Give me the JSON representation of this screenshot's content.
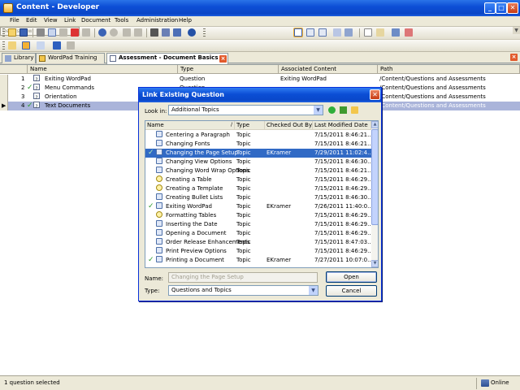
{
  "window": {
    "title": "Content - Developer"
  },
  "colors": {
    "accent": "#0a45c6",
    "selection": "#316ac5",
    "grid_selection": "#aab4da",
    "check": "#2c9b2c"
  },
  "menu": [
    "File",
    "Edit",
    "View",
    "Link",
    "Document",
    "Tools",
    "Administration",
    "Help"
  ],
  "toolbar": {
    "view_select": "Details view"
  },
  "tabs": [
    {
      "label": "Library",
      "icon": "library-icon"
    },
    {
      "label": "WordPad Training",
      "icon": "module-icon"
    },
    {
      "label": "Assessment - Document Basics",
      "icon": "assessment-icon",
      "active": true
    }
  ],
  "grid": {
    "columns": [
      "Name",
      "Type",
      "Associated Content",
      "Path"
    ],
    "rows": [
      {
        "num": "1",
        "name": "Exiting WordPad",
        "type": "Question",
        "content": "Exiting WordPad",
        "path": "/Content/Questions and Assessments",
        "check": false,
        "selected": false
      },
      {
        "num": "2",
        "name": "Menu Commands",
        "type": "Question",
        "content": "",
        "path": "/Content/Questions and Assessments",
        "check": true,
        "selected": false
      },
      {
        "num": "3",
        "name": "Orientation",
        "type": "Question",
        "content": "",
        "path": "/Content/Questions and Assessments",
        "check": false,
        "selected": false
      },
      {
        "num": "4",
        "name": "Text Documents",
        "type": "",
        "content": "",
        "path": "/Content/Questions and Assessments",
        "check": true,
        "selected": true
      }
    ]
  },
  "dialog": {
    "title": "Link Existing Question",
    "lookin_label": "Look in:",
    "lookin_value": "Additional Topics",
    "columns": [
      "Name",
      "Type",
      "Checked Out By",
      "Last Modified Date"
    ],
    "items": [
      {
        "name": "Centering a Paragraph",
        "type": "Topic",
        "checked_out": "",
        "modified": "7/15/2011 8:46:21...",
        "check": false,
        "icon": "topic-icon"
      },
      {
        "name": "Changing Fonts",
        "type": "Topic",
        "checked_out": "",
        "modified": "7/15/2011 8:46:21...",
        "check": false,
        "icon": "topic-icon"
      },
      {
        "name": "Changing the Page Setup",
        "type": "Topic",
        "checked_out": "EKramer",
        "modified": "7/29/2011 11:02:4...",
        "check": true,
        "selected": true,
        "icon": "topic-icon"
      },
      {
        "name": "Changing View Options",
        "type": "Topic",
        "checked_out": "",
        "modified": "7/15/2011 8:46:30...",
        "check": false,
        "icon": "topic-icon"
      },
      {
        "name": "Changing Word Wrap Options",
        "type": "Topic",
        "checked_out": "",
        "modified": "7/15/2011 8:46:21...",
        "check": false,
        "icon": "topic-icon"
      },
      {
        "name": "Creating a Table",
        "type": "Topic",
        "checked_out": "",
        "modified": "7/15/2011 8:46:29...",
        "check": false,
        "icon": "question-topic-icon"
      },
      {
        "name": "Creating a Template",
        "type": "Topic",
        "checked_out": "",
        "modified": "7/15/2011 8:46:29...",
        "check": false,
        "icon": "question-topic-icon"
      },
      {
        "name": "Creating Bullet Lists",
        "type": "Topic",
        "checked_out": "",
        "modified": "7/15/2011 8:46:30...",
        "check": false,
        "icon": "topic-icon"
      },
      {
        "name": "Exiting WordPad",
        "type": "Topic",
        "checked_out": "EKramer",
        "modified": "7/26/2011 11:40:0...",
        "check": true,
        "icon": "topic-icon"
      },
      {
        "name": "Formatting Tables",
        "type": "Topic",
        "checked_out": "",
        "modified": "7/15/2011 8:46:29...",
        "check": false,
        "icon": "question-topic-icon"
      },
      {
        "name": "Inserting the Date",
        "type": "Topic",
        "checked_out": "",
        "modified": "7/15/2011 8:46:29...",
        "check": false,
        "icon": "topic-icon"
      },
      {
        "name": "Opening a Document",
        "type": "Topic",
        "checked_out": "",
        "modified": "7/15/2011 8:46:29...",
        "check": false,
        "icon": "topic-icon"
      },
      {
        "name": "Order Release Enhancements",
        "type": "Topic",
        "checked_out": "",
        "modified": "7/15/2011 8:47:03...",
        "check": false,
        "icon": "topic-icon"
      },
      {
        "name": "Print Preview Options",
        "type": "Topic",
        "checked_out": "",
        "modified": "7/15/2011 8:46:29...",
        "check": false,
        "icon": "topic-icon"
      },
      {
        "name": "Printing a Document",
        "type": "Topic",
        "checked_out": "EKramer",
        "modified": "7/27/2011 10:07:0...",
        "check": true,
        "icon": "topic-icon"
      }
    ],
    "name_label": "Name:",
    "name_value": "Changing the Page Setup",
    "type_label": "Type:",
    "type_value": "Questions and Topics",
    "open_label": "Open",
    "cancel_label": "Cancel"
  },
  "status": {
    "text": "1 question selected",
    "online": "Online"
  }
}
